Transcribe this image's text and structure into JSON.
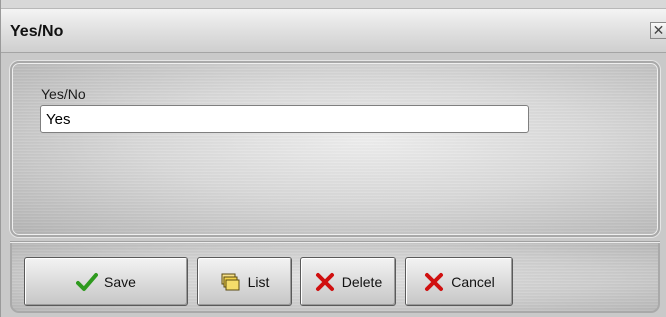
{
  "window": {
    "title": "Yes/No",
    "close_glyph": "✕"
  },
  "form": {
    "field_label": "Yes/No",
    "field_value": "Yes"
  },
  "buttons": {
    "save": {
      "label": "Save",
      "icon": "check-icon"
    },
    "list": {
      "label": "List",
      "icon": "folders-icon"
    },
    "delete": {
      "label": "Delete",
      "icon": "x-icon"
    },
    "cancel": {
      "label": "Cancel",
      "icon": "x-icon"
    }
  },
  "colors": {
    "check_green": "#2e9a1e",
    "x_red": "#d01010",
    "folder_yellow": "#f2d24a"
  }
}
